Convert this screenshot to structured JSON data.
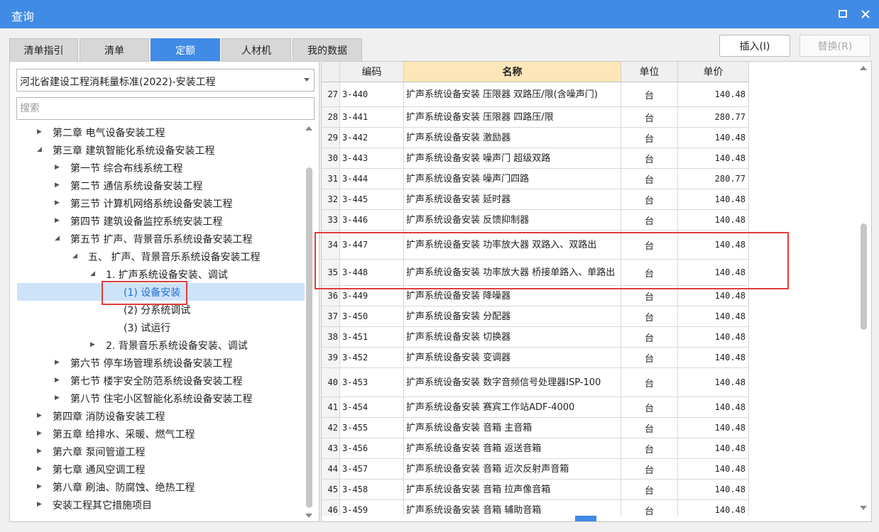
{
  "window": {
    "title": "查询"
  },
  "tabs": [
    {
      "label": "清单指引",
      "active": false
    },
    {
      "label": "清单",
      "active": false
    },
    {
      "label": "定额",
      "active": true
    },
    {
      "label": "人材机",
      "active": false
    },
    {
      "label": "我的数据",
      "active": false
    }
  ],
  "toolbar": {
    "insert_label": "插入(I)",
    "replace_label": "替换(R)"
  },
  "left": {
    "combo_value": "河北省建设工程消耗量标准(2022)-安装工程",
    "search_placeholder": "搜索",
    "tree": [
      {
        "label": "第二章 电气设备安装工程",
        "expanded": false
      },
      {
        "label": "第三章 建筑智能化系统设备安装工程",
        "expanded": true
      },
      {
        "label": "第一节 综合布线系统工程",
        "expanded": false
      },
      {
        "label": "第二节 通信系统设备安装工程",
        "expanded": false
      },
      {
        "label": "第三节 计算机网络系统设备安装工程",
        "expanded": false
      },
      {
        "label": "第四节 建筑设备监控系统安装工程",
        "expanded": false
      },
      {
        "label": "第五节 扩声、背景音乐系统设备安装工程",
        "expanded": true
      },
      {
        "label": "五、 扩声、背景音乐系统设备安装工程",
        "expanded": true
      },
      {
        "label": "1. 扩声系统设备安装、调试",
        "expanded": true
      },
      {
        "label": "(1) 设备安装",
        "selected": true
      },
      {
        "label": "(2) 分系统调试"
      },
      {
        "label": "(3) 试运行"
      },
      {
        "label": "2. 背景音乐系统设备安装、调试",
        "expanded": false
      },
      {
        "label": "第六节 停车场管理系统设备安装工程",
        "expanded": false
      },
      {
        "label": "第七节 楼宇安全防范系统设备安装工程",
        "expanded": false
      },
      {
        "label": "第八节 住宅小区智能化系统设备安装工程",
        "expanded": false
      },
      {
        "label": "第四章 消防设备安装工程",
        "expanded": false
      },
      {
        "label": "第五章 给排水、采暖、燃气工程",
        "expanded": false
      },
      {
        "label": "第六章 泵间管道工程",
        "expanded": false
      },
      {
        "label": "第七章 通风空调工程",
        "expanded": false
      },
      {
        "label": "第八章 刷油、防腐蚀、绝热工程",
        "expanded": false
      },
      {
        "label": "安装工程其它措施项目",
        "expanded": false
      }
    ]
  },
  "grid": {
    "columns": {
      "code": "编码",
      "name": "名称",
      "unit": "单位",
      "price": "单价"
    },
    "rows": [
      {
        "idx": "27",
        "code": "3-440",
        "name": "扩声系统设备安装 压限器 双路压/限(含噪声门)",
        "unit": "台",
        "price": "140.48"
      },
      {
        "idx": "28",
        "code": "3-441",
        "name": "扩声系统设备安装 压限器 四路压/限",
        "unit": "台",
        "price": "280.77"
      },
      {
        "idx": "29",
        "code": "3-442",
        "name": "扩声系统设备安装 激励器",
        "unit": "台",
        "price": "140.48"
      },
      {
        "idx": "30",
        "code": "3-443",
        "name": "扩声系统设备安装 噪声门 超级双路",
        "unit": "台",
        "price": "140.48"
      },
      {
        "idx": "31",
        "code": "3-444",
        "name": "扩声系统设备安装 噪声门四路",
        "unit": "台",
        "price": "280.77"
      },
      {
        "idx": "32",
        "code": "3-445",
        "name": "扩声系统设备安装 延时器",
        "unit": "台",
        "price": "140.48"
      },
      {
        "idx": "33",
        "code": "3-446",
        "name": "扩声系统设备安装 反馈抑制器",
        "unit": "台",
        "price": "140.48"
      },
      {
        "idx": "34",
        "code": "3-447",
        "name": "扩声系统设备安装 功率放大器 双路入、双路出",
        "unit": "台",
        "price": "140.48"
      },
      {
        "idx": "35",
        "code": "3-448",
        "name": "扩声系统设备安装 功率放大器 桥接单路入、单路出",
        "unit": "台",
        "price": "140.48"
      },
      {
        "idx": "36",
        "code": "3-449",
        "name": "扩声系统设备安装 降噪器",
        "unit": "台",
        "price": "140.48"
      },
      {
        "idx": "37",
        "code": "3-450",
        "name": "扩声系统设备安装 分配器",
        "unit": "台",
        "price": "140.48"
      },
      {
        "idx": "38",
        "code": "3-451",
        "name": "扩声系统设备安装 切换器",
        "unit": "台",
        "price": "140.48"
      },
      {
        "idx": "39",
        "code": "3-452",
        "name": "扩声系统设备安装 变调器",
        "unit": "台",
        "price": "140.48"
      },
      {
        "idx": "40",
        "code": "3-453",
        "name": "扩声系统设备安装 数字音频信号处理器ISP-100",
        "unit": "台",
        "price": "140.48"
      },
      {
        "idx": "41",
        "code": "3-454",
        "name": "扩声系统设备安装 赛宾工作站ADF-4000",
        "unit": "台",
        "price": "140.48"
      },
      {
        "idx": "42",
        "code": "3-455",
        "name": "扩声系统设备安装 音箱 主音箱",
        "unit": "台",
        "price": "140.48"
      },
      {
        "idx": "43",
        "code": "3-456",
        "name": "扩声系统设备安装 音箱 返送音箱",
        "unit": "台",
        "price": "140.48"
      },
      {
        "idx": "44",
        "code": "3-457",
        "name": "扩声系统设备安装 音箱 近次反射声音箱",
        "unit": "台",
        "price": "140.48"
      },
      {
        "idx": "45",
        "code": "3-458",
        "name": "扩声系统设备安装 音箱 拉声像音箱",
        "unit": "台",
        "price": "140.48"
      },
      {
        "idx": "46",
        "code": "3-459",
        "name": "扩声系统设备安装 音箱 辅助音箱",
        "unit": "台",
        "price": "140.48"
      }
    ]
  },
  "colors": {
    "accent": "#3f8be6",
    "highlight_header": "#fde7b8",
    "selected_row": "#cde3fa",
    "annotation": "#e03c3c"
  }
}
